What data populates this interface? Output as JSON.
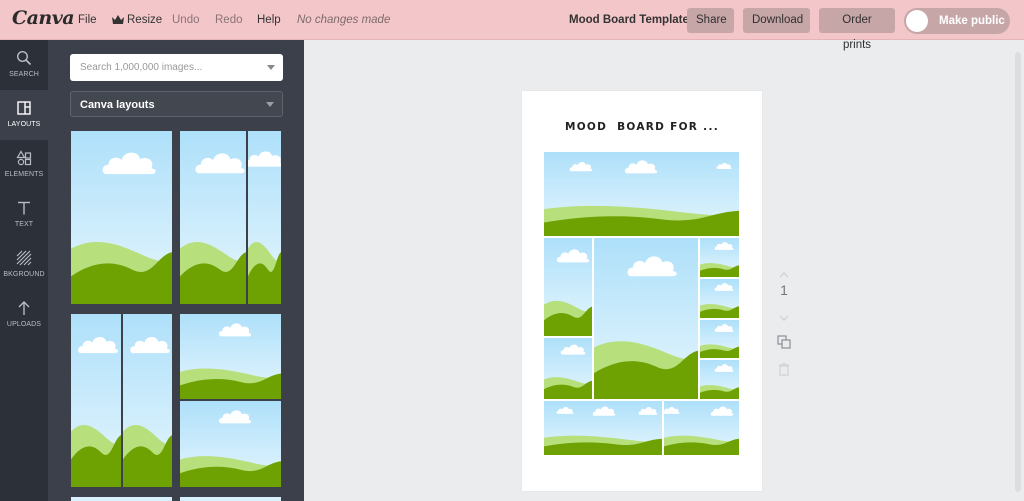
{
  "app": {
    "logo": "Canva"
  },
  "menu": {
    "file": "File",
    "resize": "Resize",
    "undo": "Undo",
    "redo": "Redo",
    "help": "Help",
    "status": "No changes made"
  },
  "header": {
    "document_title": "Mood Board Template",
    "share": "Share",
    "download": "Download",
    "order_prints": "Order prints",
    "make_public": "Make public"
  },
  "rail": {
    "items": [
      {
        "label": "SEARCH",
        "icon": "search-icon"
      },
      {
        "label": "LAYOUTS",
        "icon": "layouts-icon"
      },
      {
        "label": "ELEMENTS",
        "icon": "elements-icon"
      },
      {
        "label": "TEXT",
        "icon": "text-icon"
      },
      {
        "label": "BKGROUND",
        "icon": "background-icon"
      },
      {
        "label": "UPLOADS",
        "icon": "upload-icon"
      }
    ],
    "active": "LAYOUTS"
  },
  "panel": {
    "search_placeholder": "Search 1,000,000 images...",
    "layout_select": "Canva layouts"
  },
  "page": {
    "title": "MOOD  BOARD FOR ...",
    "number": "1"
  },
  "colors": {
    "topbar": "#f3c6c9",
    "button": "#c7a6a8",
    "rail": "#2c3038",
    "panel": "#3b404a",
    "sky": "#bfe7fb",
    "hill_light": "#b7df7c",
    "hill_dark": "#6ea203"
  }
}
